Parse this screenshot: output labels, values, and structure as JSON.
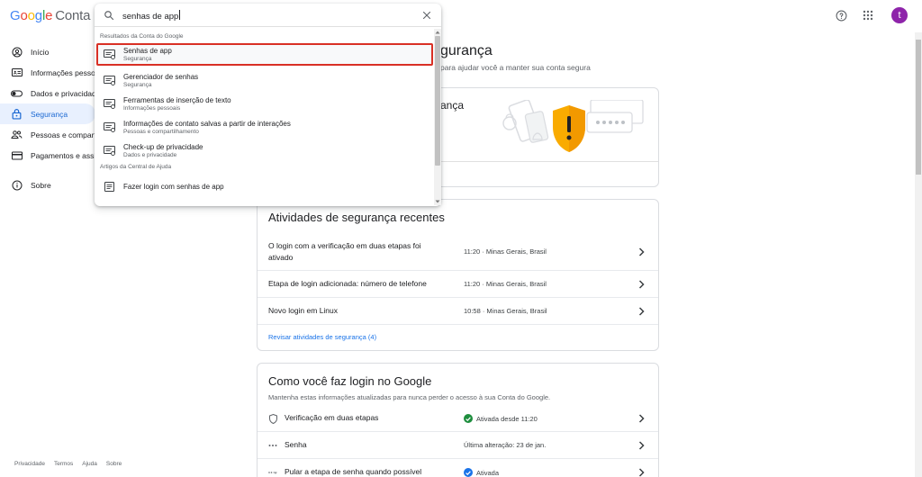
{
  "header": {
    "logo_letters": [
      "G",
      "o",
      "o",
      "g",
      "l",
      "e"
    ],
    "logo_suffix": "Conta",
    "avatar_letter": "t"
  },
  "sidebar": {
    "items": [
      {
        "label": "Início",
        "icon": "account-circle-icon"
      },
      {
        "label": "Informações pessoais",
        "icon": "id-card-icon"
      },
      {
        "label": "Dados e privacidade",
        "icon": "toggle-icon"
      },
      {
        "label": "Segurança",
        "icon": "lock-icon",
        "active": true
      },
      {
        "label": "Pessoas e compartilhamento",
        "icon": "people-icon"
      },
      {
        "label": "Pagamentos e assinaturas",
        "icon": "credit-card-icon"
      },
      {
        "label": "Sobre",
        "icon": "info-icon"
      }
    ],
    "footer": [
      "Privacidade",
      "Termos",
      "Ajuda",
      "Sobre"
    ]
  },
  "main": {
    "title_fragment": "gurança",
    "subtitle_fragment": "para ajudar você a manter sua conta segura",
    "top_card_title_fragment": "ança",
    "activity": {
      "title": "Atividades de segurança recentes",
      "rows": [
        {
          "label": "O login com a verificação em duas etapas foi ativado",
          "meta": "11:20 · Minas Gerais, Brasil"
        },
        {
          "label": "Etapa de login adicionada: número de telefone",
          "meta": "11:20 · Minas Gerais, Brasil"
        },
        {
          "label": "Novo login em Linux",
          "meta": "10:58 · Minas Gerais, Brasil"
        }
      ],
      "link": "Revisar atividades de segurança (4)"
    },
    "login": {
      "title": "Como você faz login no Google",
      "description": "Mantenha estas informações atualizadas para nunca perder o acesso à sua Conta do Google.",
      "rows": [
        {
          "label": "Verificação em duas etapas",
          "status": "Ativada desde 11:20",
          "icon": "shield-outline-icon",
          "status_icon": "check-circle-icon"
        },
        {
          "label": "Senha",
          "status": "Última alteração: 23 de jan.",
          "icon": "password-dots-icon"
        },
        {
          "label": "Pular a etapa de senha quando possível",
          "status": "Ativada",
          "icon": "passkey-icon",
          "status_icon": "check-badge-icon"
        }
      ]
    }
  },
  "search": {
    "query": "senhas de app",
    "section_account": "Resultados da Conta do Google",
    "results": [
      {
        "title": "Senhas de app",
        "subtitle": "Segurança",
        "highlight": true
      },
      {
        "title": "Gerenciador de senhas",
        "subtitle": "Segurança"
      },
      {
        "title": "Ferramentas de inserção de texto",
        "subtitle": "Informações pessoais"
      },
      {
        "title": "Informações de contato salvas a partir de interações",
        "subtitle": "Pessoas e compartilhamento"
      },
      {
        "title": "Check-up de privacidade",
        "subtitle": "Dados e privacidade"
      }
    ],
    "section_help": "Artigos da Central de Ajuda",
    "help_results": [
      {
        "title": "Fazer login com senhas de app"
      }
    ]
  },
  "colors": {
    "accent": "#1a73e8",
    "active_bg": "#e8f0fe",
    "highlight_border": "#d93025",
    "ok_green": "#1e8e3e",
    "shield_orange": "#f9ab00",
    "avatar": "#8e24aa"
  }
}
